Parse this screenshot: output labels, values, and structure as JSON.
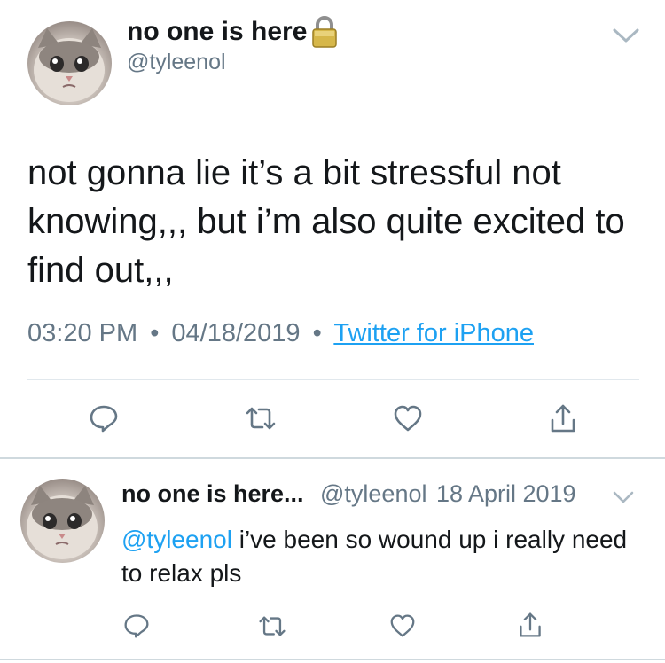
{
  "main_tweet": {
    "display_name": "no one is here",
    "handle": "@tyleenol",
    "text": "not gonna lie it’s a bit stressful not knowing,,, but i’m also quite excited to find out,,,",
    "time": "03:20 PM",
    "separator": "•",
    "date": "04/18/2019",
    "source": "Twitter for iPhone",
    "icons": [
      "lock-icon",
      "chevron-down-icon",
      "reply-icon",
      "retweet-icon",
      "like-icon",
      "share-icon"
    ]
  },
  "reply_tweet": {
    "display_name": "no one is here...",
    "handle": "@tyleenol",
    "date": "18 April 2019",
    "mention": "@tyleenol",
    "text": " i’ve been so wound up i really need to relax pls",
    "icons": [
      "chevron-down-icon",
      "reply-icon",
      "retweet-icon",
      "like-icon",
      "share-icon"
    ]
  },
  "colors": {
    "text": "#14171a",
    "secondary": "#657786",
    "link": "#1da1f2",
    "divider": "#e1e8ed"
  }
}
